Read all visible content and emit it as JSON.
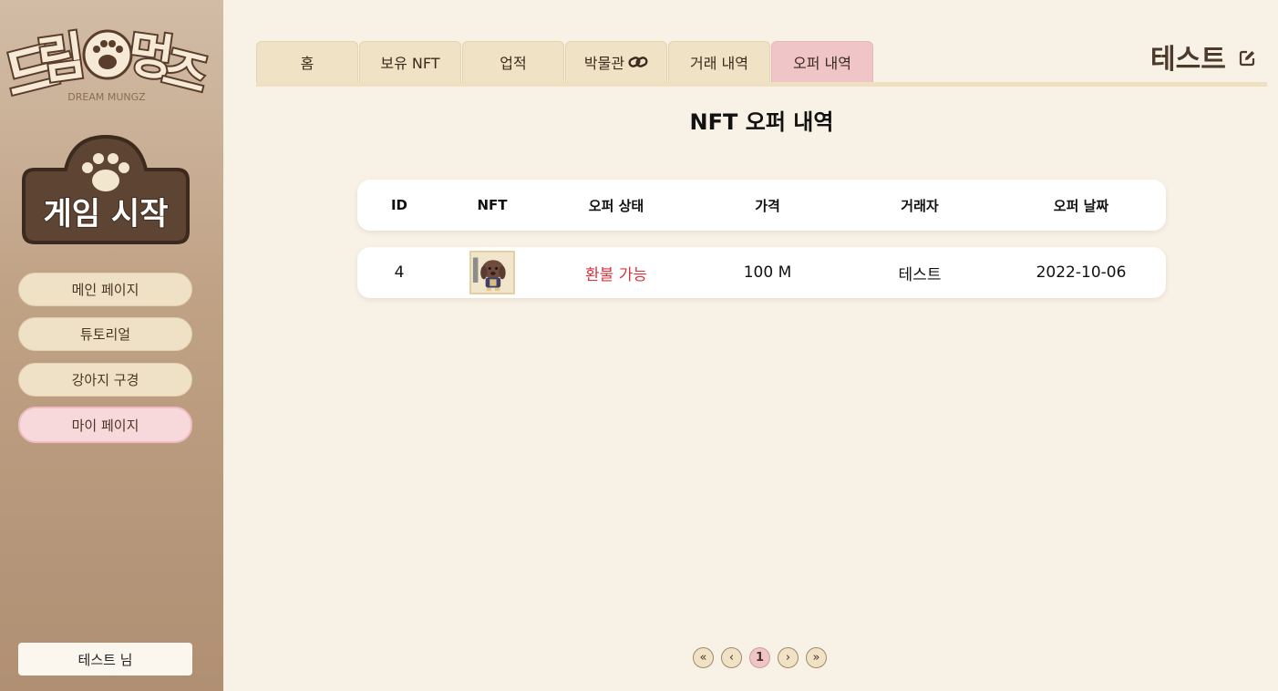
{
  "sidebar": {
    "logo_text": "드림멍즈",
    "logo_subtext": "DREAM MUNGZ",
    "game_start_label": "게임 시작",
    "menu": [
      {
        "label": "메인 페이지",
        "active": false
      },
      {
        "label": "튜토리얼",
        "active": false
      },
      {
        "label": "강아지 구경",
        "active": false
      },
      {
        "label": "마이 페이지",
        "active": true
      }
    ],
    "user_label": "테스트 님"
  },
  "tabs": [
    {
      "label": "홈",
      "icon": null
    },
    {
      "label": "보유 NFT",
      "icon": null
    },
    {
      "label": "업적",
      "icon": null
    },
    {
      "label": "박물관",
      "icon": "link-icon"
    },
    {
      "label": "거래 내역",
      "icon": null
    },
    {
      "label": "오퍼 내역",
      "icon": null,
      "active": true
    }
  ],
  "profile": {
    "name": "테스트",
    "edit_icon": "edit-icon"
  },
  "page_title": "NFT 오퍼 내역",
  "table": {
    "headers": [
      "ID",
      "NFT",
      "오퍼 상태",
      "가격",
      "거래자",
      "오퍼 날짜"
    ],
    "rows": [
      {
        "id": "4",
        "nft": "dog-nft-thumbnail",
        "status": "환불 가능",
        "price": "100 M",
        "trader": "테스트",
        "date": "2022-10-06"
      }
    ]
  },
  "pagination": {
    "first": "«",
    "prev": "‹",
    "current": "1",
    "next": "›",
    "last": "»"
  },
  "colors": {
    "accent_pink": "#efc5c8",
    "tab_beige": "#f0e2c5",
    "status_red": "#d9343f",
    "brown": "#4d3a2a"
  }
}
